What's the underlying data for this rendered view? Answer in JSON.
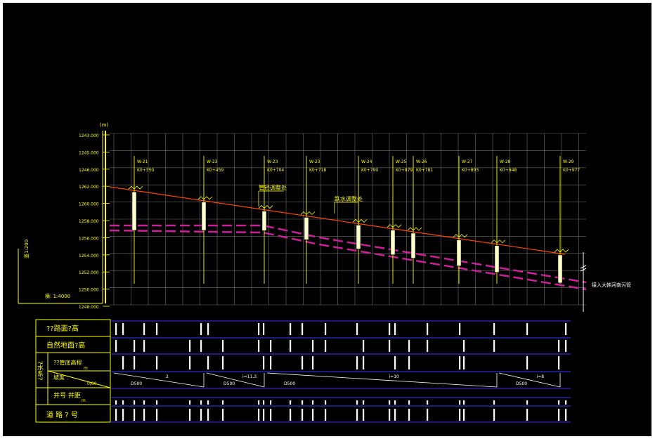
{
  "colors": {
    "background": "#000000",
    "grid": "#8a8a8a",
    "axis": "#ffff00",
    "label": "#ffff00",
    "ground_line": "#ff4500",
    "pipe_line": "#cc1f9a",
    "table_line": "#3333ff",
    "well": "#ffffcc"
  },
  "profile": {
    "unit": "(m)",
    "vertical_scale": "竖1:200",
    "horizontal_scale": "横: 1:4000",
    "y_ticks": [
      "1243.000",
      "1245.000",
      "1246.000",
      "1262.000",
      "1260.000",
      "1258.000",
      "1256.000",
      "1254.000",
      "1252.000",
      "1250.000",
      "1248.000"
    ],
    "wells": [
      {
        "id": "W-21",
        "station": "K0+350"
      },
      {
        "id": "W-23",
        "station": "K0+459"
      },
      {
        "id": "W-23",
        "station": "K0+704"
      },
      {
        "id": "W-23",
        "station": "K0+718"
      },
      {
        "id": "W-24",
        "station": "K0+790"
      },
      {
        "id": "W-25",
        "station": "K0+879"
      },
      {
        "id": "W-26",
        "station": "K0+781"
      },
      {
        "id": "W-27",
        "station": "K0+893"
      },
      {
        "id": "W-28",
        "station": "K0+948"
      },
      {
        "id": "W-29",
        "station": "K0+977"
      }
    ],
    "note_1": "管径调整处",
    "note_2": "跌水调整处",
    "outlet_label": "接入大韩河南污管"
  },
  "table_rows": [
    {
      "label": "??路面?高"
    },
    {
      "label": "自然地面?高"
    },
    {
      "label": "??管底高程"
    },
    {
      "label": "坡度"
    },
    {
      "label": "井号  井距"
    },
    {
      "label": "道 路 ? 号"
    }
  ],
  "table_side_label": "?水系?",
  "table_sub_labels": {
    "pipe_depth_unit": "m",
    "slope_unit": "0/00",
    "length_unit": "m",
    "distance_unit": "m"
  },
  "segments": [
    {
      "pipe": "D500",
      "slope": "2"
    },
    {
      "pipe": "D500",
      "slope": "i=11.3"
    },
    {
      "pipe": "D500",
      "slope": "i=10"
    },
    {
      "pipe": "D500",
      "slope": "i=8"
    }
  ]
}
